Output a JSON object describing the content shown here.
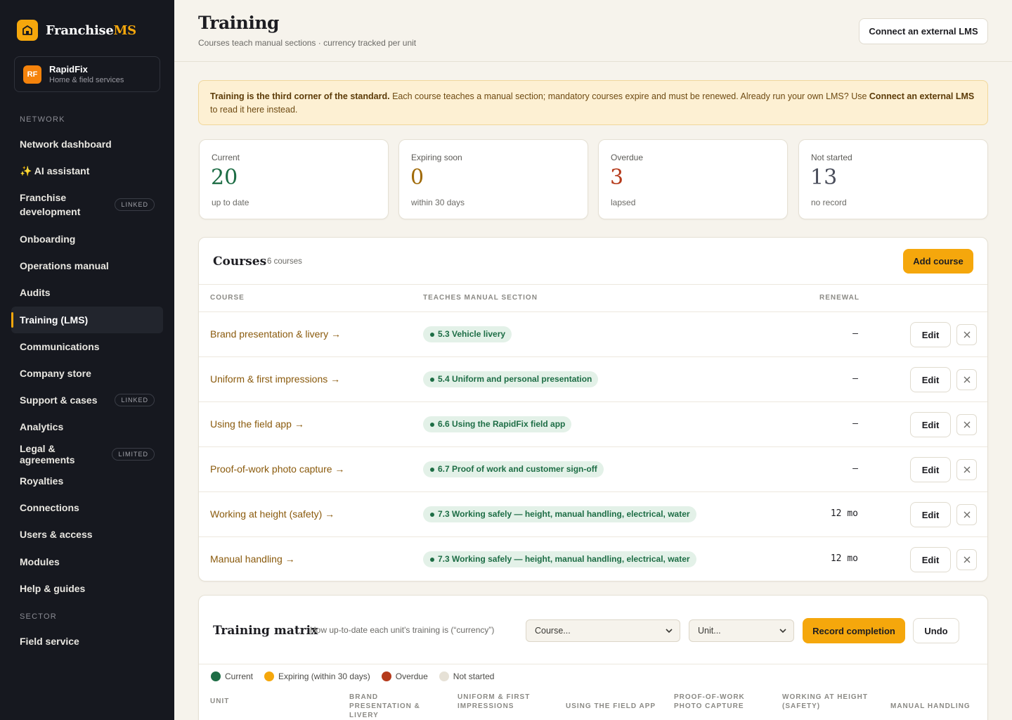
{
  "brand": {
    "name_main": "Franchise",
    "name_accent": "MS"
  },
  "tenant": {
    "initials": "RF",
    "name": "RapidFix",
    "subtitle": "Home & field services"
  },
  "sidebar": {
    "section_network": "NETWORK",
    "section_sector": "SECTOR",
    "items": [
      {
        "label": "Network dashboard",
        "badge": ""
      },
      {
        "label": "✨ AI assistant",
        "badge": ""
      },
      {
        "label": "Franchise development",
        "badge": "LINKED"
      },
      {
        "label": "Onboarding",
        "badge": ""
      },
      {
        "label": "Operations manual",
        "badge": ""
      },
      {
        "label": "Audits",
        "badge": ""
      },
      {
        "label": "Training (LMS)",
        "badge": ""
      },
      {
        "label": "Communications",
        "badge": ""
      },
      {
        "label": "Company store",
        "badge": ""
      },
      {
        "label": "Support & cases",
        "badge": "LINKED"
      },
      {
        "label": "Analytics",
        "badge": ""
      },
      {
        "label": "Legal & agreements",
        "badge": "LIMITED"
      },
      {
        "label": "Royalties",
        "badge": ""
      },
      {
        "label": "Connections",
        "badge": ""
      },
      {
        "label": "Users & access",
        "badge": ""
      },
      {
        "label": "Modules",
        "badge": ""
      },
      {
        "label": "Help & guides",
        "badge": ""
      }
    ],
    "sector_items": [
      {
        "label": "Field service"
      }
    ],
    "active": "Training (LMS)"
  },
  "header": {
    "title": "Training",
    "subtitle": "Courses teach manual sections · currency tracked per unit",
    "connect_button": "Connect an external LMS"
  },
  "notice": {
    "bold_lead": "Training is the third corner of the standard.",
    "text": " Each course teaches a manual section; mandatory courses expire and must be renewed. Already run your own LMS? Use ",
    "bold_link": "Connect an external LMS",
    "tail": " to read it here instead."
  },
  "stats": [
    {
      "label": "Current",
      "value": "20",
      "sub": "up to date",
      "color": "#1d6d45"
    },
    {
      "label": "Expiring soon",
      "value": "0",
      "sub": "within 30 days",
      "color": "#a06a08"
    },
    {
      "label": "Overdue",
      "value": "3",
      "sub": "lapsed",
      "color": "#b53a1b"
    },
    {
      "label": "Not started",
      "value": "13",
      "sub": "no record",
      "color": "#4b4f5c"
    }
  ],
  "courses": {
    "title": "Courses",
    "count": "6 courses",
    "add_button": "Add course",
    "columns": {
      "course": "COURSE",
      "section": "TEACHES MANUAL SECTION",
      "renewal": "RENEWAL"
    },
    "edit_label": "Edit",
    "rows": [
      {
        "name": "Brand presentation & livery →",
        "section": "5.3 Vehicle livery",
        "renewal": "–"
      },
      {
        "name": "Uniform & first impressions →",
        "section": "5.4 Uniform and personal presentation",
        "renewal": "–"
      },
      {
        "name": "Using the field app →",
        "section": "6.6 Using the RapidFix field app",
        "renewal": "–"
      },
      {
        "name": "Proof-of-work photo capture →",
        "section": "6.7 Proof of work and customer sign-off",
        "renewal": "–"
      },
      {
        "name": "Working at height (safety) →",
        "section": "7.3 Working safely — height, manual handling, electrical, water",
        "renewal": "12 mo"
      },
      {
        "name": "Manual handling →",
        "section": "7.3 Working safely — height, manual handling, electrical, water",
        "renewal": "12 mo"
      }
    ]
  },
  "matrix": {
    "title": "Training matrix",
    "subtitle": "How up-to-date each unit's training is (“currency”)",
    "course_select": "Course...",
    "unit_select": "Unit...",
    "record_button": "Record completion",
    "undo_button": "Undo",
    "legend": [
      {
        "label": "Current",
        "color": "#1d6d45"
      },
      {
        "label": "Expiring (within 30 days)",
        "color": "#f5a70c"
      },
      {
        "label": "Overdue",
        "color": "#b53a1b"
      },
      {
        "label": "Not started",
        "color": "#e6e1d6"
      }
    ],
    "columns": [
      "UNIT",
      "BRAND PRESENTATION & LIVERY",
      "UNIFORM & FIRST IMPRESSIONS",
      "USING THE FIELD APP",
      "PROOF-OF-WORK PHOTO CAPTURE",
      "WORKING AT HEIGHT (SAFETY)",
      "MANUAL HANDLING"
    ]
  }
}
